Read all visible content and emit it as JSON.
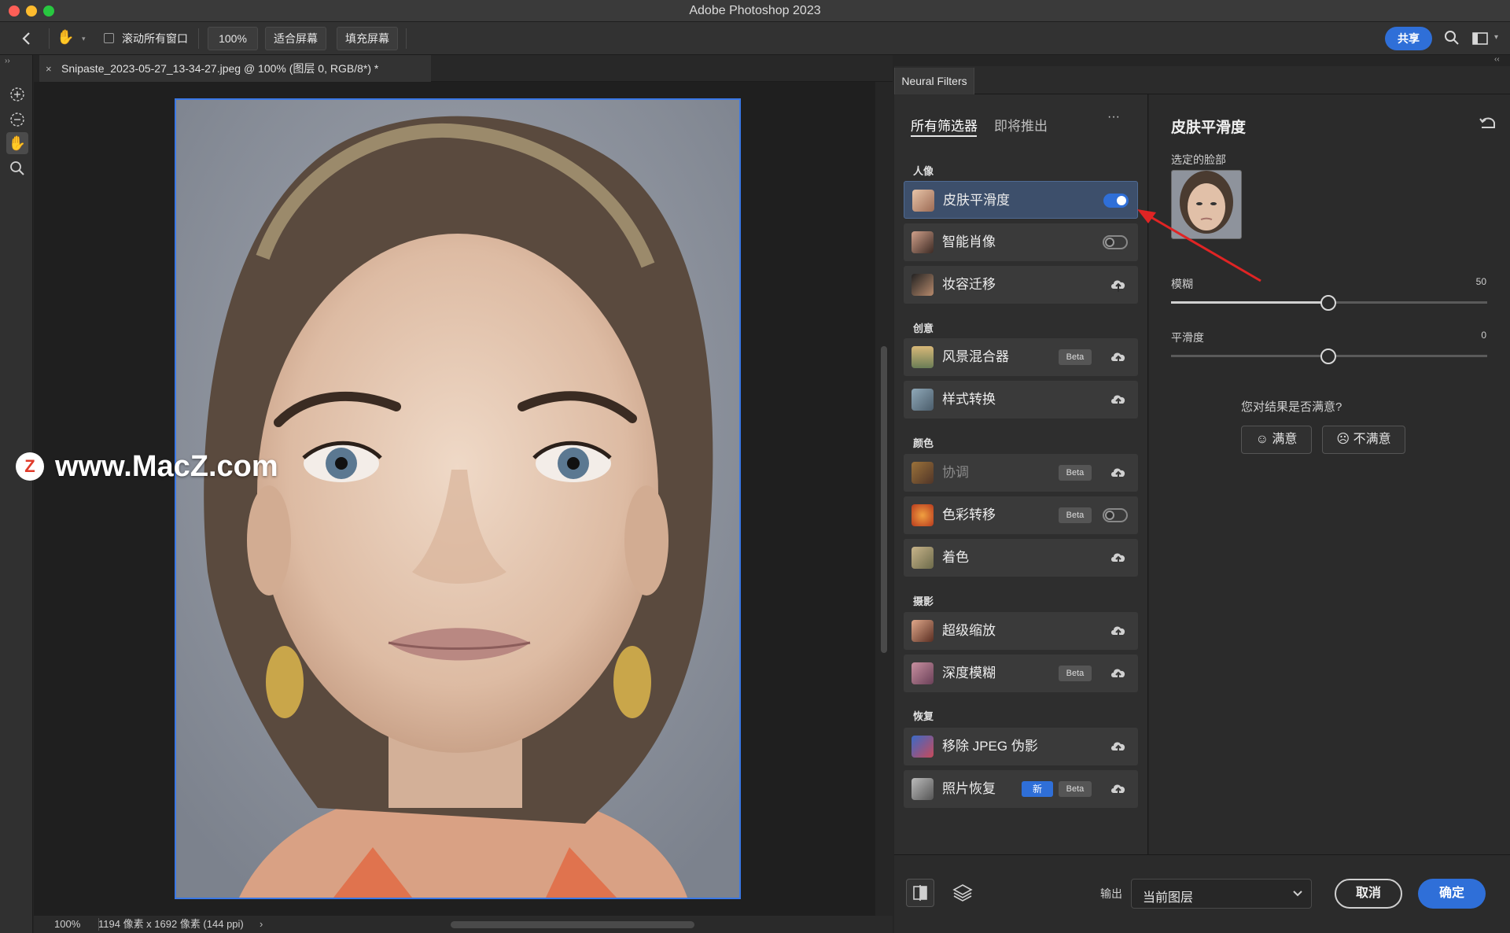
{
  "app": {
    "title": "Adobe Photoshop 2023"
  },
  "options_bar": {
    "scroll_all_label": "滚动所有窗口",
    "zoom_label": "100%",
    "fit_label": "适合屏幕",
    "fill_label": "填充屏幕",
    "share_label": "共享"
  },
  "document": {
    "tab_title": "Snipaste_2023-05-27_13-34-27.jpeg @ 100% (图层 0, RGB/8*) *",
    "zoom": "100%",
    "info": "1194 像素 x 1692 像素 (144 ppi)"
  },
  "watermark": {
    "text": "www.MacZ.com",
    "badge": "Z"
  },
  "neural_filters": {
    "panel_tab": "Neural Filters",
    "tabs": [
      "所有筛选器",
      "即将推出"
    ],
    "more": "···",
    "sections": [
      {
        "title": "人像",
        "filters": [
          {
            "name": "皮肤平滑度",
            "state": "on"
          },
          {
            "name": "智能肖像",
            "state": "off"
          },
          {
            "name": "妆容迁移",
            "state": "cloud"
          }
        ]
      },
      {
        "title": "创意",
        "filters": [
          {
            "name": "风景混合器",
            "beta": "Beta",
            "state": "cloud"
          },
          {
            "name": "样式转换",
            "state": "cloud"
          }
        ]
      },
      {
        "title": "颜色",
        "filters": [
          {
            "name": "协调",
            "beta": "Beta",
            "state": "cloud",
            "dim": true
          },
          {
            "name": "色彩转移",
            "beta": "Beta",
            "state": "off"
          },
          {
            "name": "着色",
            "state": "cloud"
          }
        ]
      },
      {
        "title": "摄影",
        "filters": [
          {
            "name": "超级缩放",
            "state": "cloud"
          },
          {
            "name": "深度模糊",
            "beta": "Beta",
            "state": "cloud"
          }
        ]
      },
      {
        "title": "恢复",
        "filters": [
          {
            "name": "移除 JPEG 伪影",
            "state": "cloud"
          },
          {
            "name": "照片恢复",
            "new": "新",
            "beta": "Beta",
            "state": "cloud"
          }
        ]
      }
    ],
    "detail": {
      "title": "皮肤平滑度",
      "face_label": "选定的脸部",
      "sliders": [
        {
          "label": "模糊",
          "value": "50",
          "level": 0.5
        },
        {
          "label": "平滑度",
          "value": "0",
          "level": 0.5
        }
      ],
      "feedback_question": "您对结果是否满意?",
      "satisfied": "满意",
      "unsatisfied": "不满意"
    },
    "bottom": {
      "output_label": "输出",
      "output_value": "当前图层",
      "cancel": "取消",
      "ok": "确定"
    }
  },
  "colors": {
    "accent": "#2f6fd8",
    "annotation_arrow": "#e02424"
  }
}
